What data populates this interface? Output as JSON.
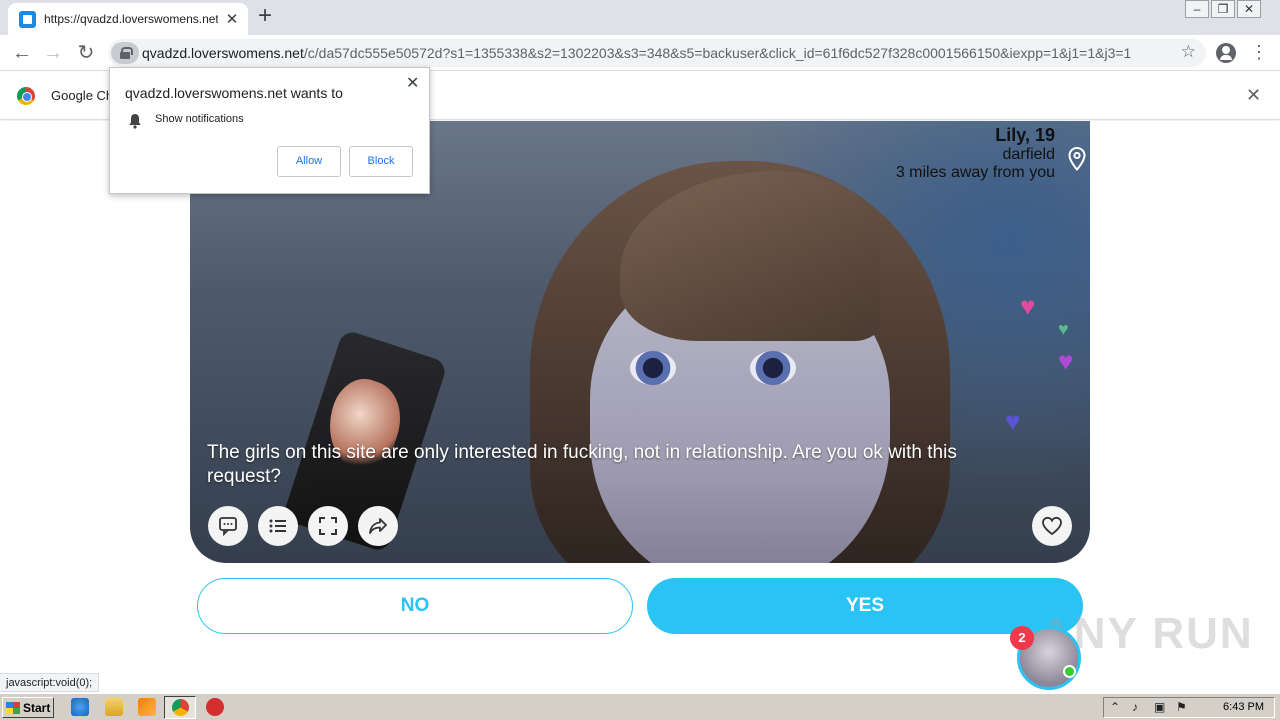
{
  "browser": {
    "tab_title": "https://qvadzd.loverswomens.net/c",
    "url_host": "qvadzd.loverswomens.net",
    "url_path": "/c/da57dc555e50572d?s1=1355338&s2=1302203&s3=348&s5=backuser&click_id=61f6dc527f328c0001566150&iexpp=1&j1=1&j3=1",
    "infobar_text": "Google Ch"
  },
  "permission_popup": {
    "title": "qvadzd.loverswomens.net wants to",
    "item": "Show notifications",
    "allow_label": "Allow",
    "block_label": "Block"
  },
  "profile": {
    "name": "Lily, 19",
    "city": "darfield",
    "distance": "3 miles away from you"
  },
  "question": "The girls on this site are only interested in fucking, not in relationship. Are you ok with this request?",
  "answers": {
    "no": "NO",
    "yes": "YES"
  },
  "chat": {
    "badge_count": "2"
  },
  "watermark": "ANY RUN",
  "status_bar": "javascript:void(0);",
  "taskbar": {
    "start_label": "Start",
    "clock": "6:43 PM"
  },
  "colors": {
    "accent": "#2ac4f4",
    "badge": "#f2384a",
    "online": "#33cc33"
  }
}
